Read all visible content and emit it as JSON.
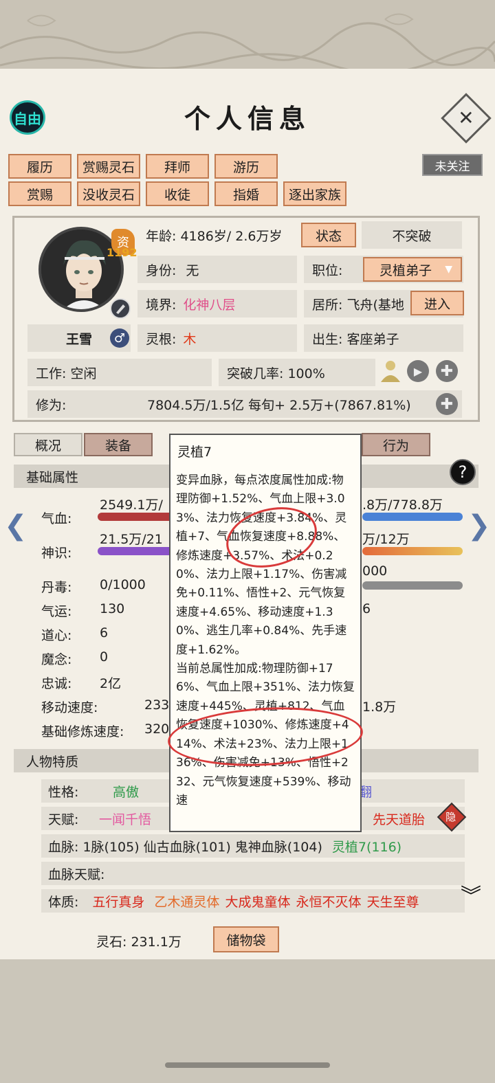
{
  "header": {
    "title": "个人信息",
    "mode_label": "自由",
    "close_symbol": "✕",
    "follow_label": "未关注"
  },
  "actions": {
    "row1": [
      "履历",
      "赏赐灵石",
      "拜师",
      "游历"
    ],
    "row2": [
      "赏赐",
      "没收灵石",
      "收徒",
      "指婚",
      "逐出家族"
    ]
  },
  "profile": {
    "name": "王雪",
    "gender_icon": "♂",
    "aptitude_badge": "资",
    "aptitude_value": "1192",
    "age": "年龄: 4186岁/ 2.6万岁",
    "status_button": "状态",
    "breakthrough_button": "不突破",
    "identity_label": "身份:",
    "identity_value": "无",
    "position_label": "职位:",
    "position_value": "灵植弟子",
    "realm_label": "境界:",
    "realm_value": "化神八层",
    "residence": "居所: 飞舟(基地",
    "enter_button": "进入",
    "root_label": "灵根:",
    "root_value": "木",
    "birth": "出生:  客座弟子",
    "work": "工作: 空闲",
    "breakthrough_rate": "突破几率:  100%",
    "cultivation_label": "修为:",
    "cultivation_value": "7804.5万/1.5亿  每旬+  2.5万+(7867.81%)"
  },
  "tabs": [
    "概况",
    "装备",
    "行为"
  ],
  "basic": {
    "header": "基础属性",
    "hp_label": "气血:",
    "hp_value": "2549.1万/",
    "hp_right": ".8万/778.8万",
    "spirit_label": "神识:",
    "spirit_value": "21.5万/21",
    "spirit_right": "万/12万",
    "right_3": "000",
    "right_4": "6",
    "right_5": "1.8万",
    "rows": [
      {
        "label": "丹毒:",
        "value": "0/1000"
      },
      {
        "label": "气运:",
        "value": "130"
      },
      {
        "label": "道心:",
        "value": "6"
      },
      {
        "label": "魔念:",
        "value": "0"
      },
      {
        "label": "忠诚:",
        "value": "2亿"
      },
      {
        "label": "移动速度:",
        "value": "233"
      },
      {
        "label": "基础修炼速度:",
        "value": "320"
      }
    ]
  },
  "traits": {
    "header": "人物特质",
    "personality_label": "性格:",
    "personality_value": "高傲",
    "personality_right": "翻",
    "talent_label": "天赋:",
    "talent_value": "一闻千悟",
    "talent_right": "先天道胎",
    "hidden_badge": "隐",
    "bloodline": "血脉: 1脉(105)  仙古血脉(101)  鬼神血脉(104)",
    "bloodline_highlight": "灵植7(116)",
    "bloodline_talent": "血脉天赋:",
    "physique_label": "体质:",
    "physique": [
      "五行真身",
      "乙木通灵体",
      "大成鬼童体",
      "永恒不灭体",
      "天生至尊"
    ],
    "more_symbol": "︾"
  },
  "footer": {
    "stones": "灵石: 231.1万",
    "bag_button": "储物袋"
  },
  "tooltip": {
    "title": "灵植7",
    "p1": "变异血脉，每点浓度属性加成:物理防御+1.52%、气血上限+3.03%、法力恢复速度+3.84%、灵植+7、气血恢复速度+8.88%、修炼速度+3.57%、术法+0.20%、法力上限+1.17%、伤害减免+0.11%、悟性+2、元气恢复速度+4.65%、移动速度+1.30%、逃生几率+0.84%、先手速度+1.62%。",
    "p2": "当前总属性加成:物理防御+176%、气血上限+351%、法力恢复速度+445%、灵植+812、气血恢复速度+1030%、修炼速度+414%、术法+23%、法力上限+136%、伤害减免+13%、悟性+232、元气恢复速度+539%、移动速"
  },
  "colors": {
    "realm": "#e0508a",
    "root": "#e03a1a",
    "physique": "#d8281c",
    "talent": "#e35aa0",
    "personality": "#2f9a4a",
    "bloodline_highlight": "#2f9a4a"
  }
}
